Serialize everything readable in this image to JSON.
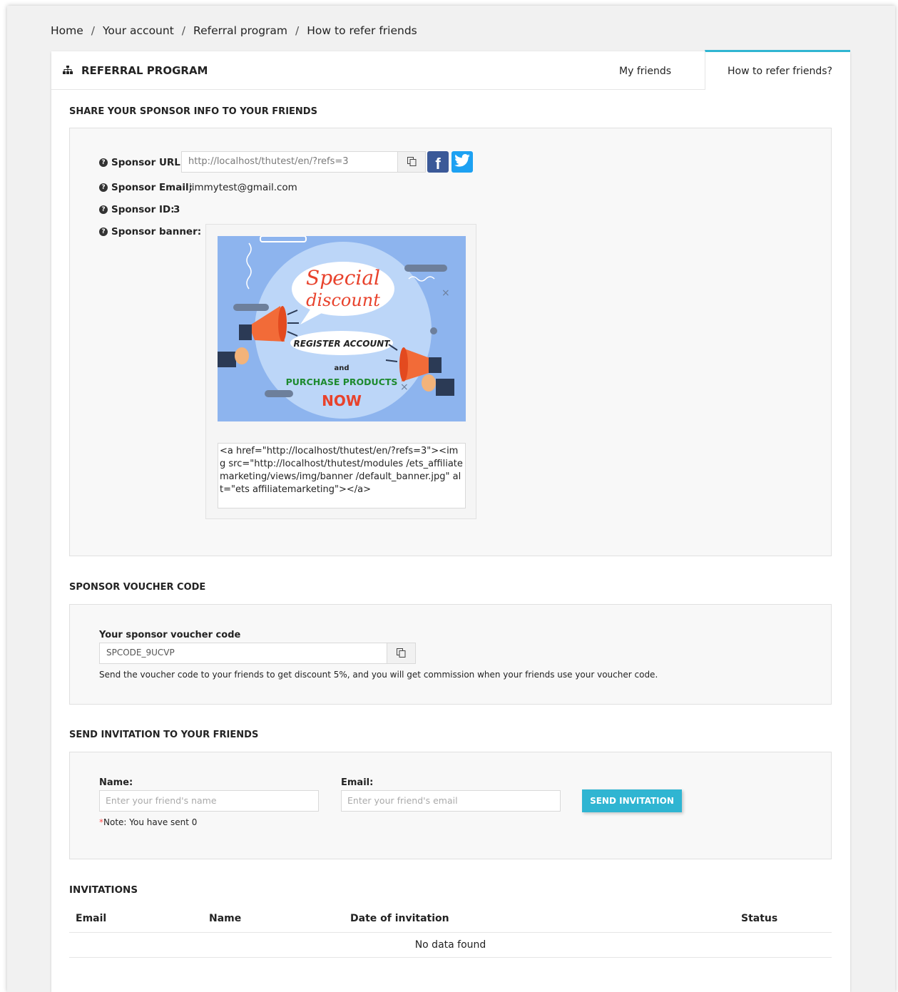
{
  "breadcrumb": [
    "Home",
    "Your account",
    "Referral program",
    "How to refer friends"
  ],
  "header": {
    "title": "REFERRAL PROGRAM",
    "tabs": [
      {
        "label": "My friends",
        "active": false
      },
      {
        "label": "How to refer friends?",
        "active": true
      }
    ]
  },
  "share": {
    "section_title": "SHARE YOUR SPONSOR INFO TO YOUR FRIENDS",
    "url_label": "Sponsor URL:",
    "url_value": "http://localhost/thutest/en/?refs=3",
    "email_label": "Sponsor Email:",
    "email_value": "jimmytest@gmail.com",
    "id_label": "Sponsor ID:",
    "id_value": "3",
    "banner_label": "Sponsor banner:",
    "banner": {
      "line1": "Special",
      "line2": "discount",
      "register": "REGISTER ACCOUNT",
      "and": "and",
      "purchase": "PURCHASE PRODUCTS",
      "now": "NOW"
    },
    "banner_code": "<a href=\"http://localhost/thutest/en/?refs=3\"><img src=\"http://localhost/thutest/modules /ets_affiliatemarketing/views/img/banner /default_banner.jpg\" alt=\"ets affiliatemarketing\"></a>"
  },
  "voucher": {
    "section_title": "SPONSOR VOUCHER CODE",
    "label": "Your sponsor voucher code",
    "code": "SPCODE_9UCVP",
    "description": "Send the voucher code to your friends to get discount 5%, and you will get commission when your friends use your voucher code."
  },
  "invite": {
    "section_title": "SEND INVITATION TO YOUR FRIENDS",
    "name_label": "Name:",
    "name_placeholder": "Enter your friend's name",
    "email_label": "Email:",
    "email_placeholder": "Enter your friend's email",
    "button": "SEND INVITATION",
    "note_star": "*",
    "note": "Note: You have sent 0"
  },
  "invitations": {
    "section_title": "INVITATIONS",
    "columns": [
      "Email",
      "Name",
      "Date of invitation",
      "Status"
    ],
    "empty": "No data found"
  },
  "colors": {
    "accent": "#2fb5d2",
    "facebook": "#3b5998",
    "twitter": "#1da1f2",
    "required": "#ff4c4c"
  }
}
